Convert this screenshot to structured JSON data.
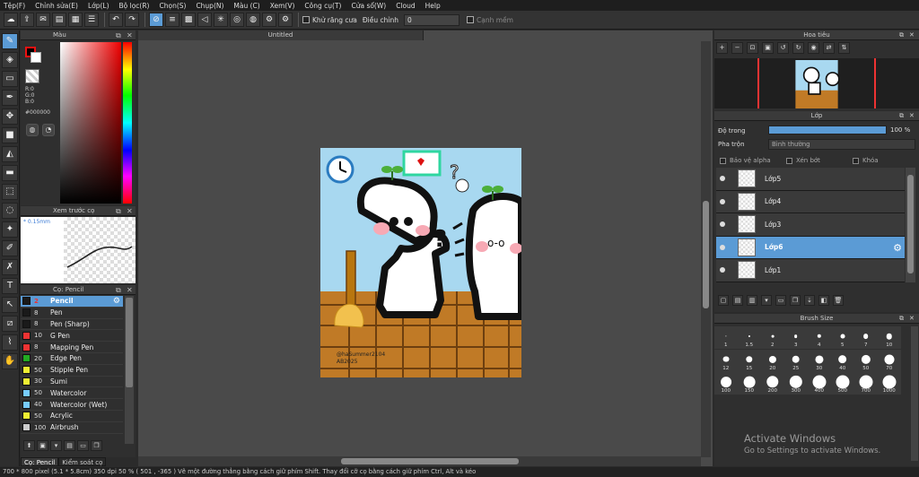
{
  "menu": [
    "Tệp(F)",
    "Chỉnh sửa(E)",
    "Lớp(L)",
    "Bộ lọc(R)",
    "Chọn(S)",
    "Chụp(N)",
    "Màu (C)",
    "Xem(V)",
    "Công cụ(T)",
    "Cửa sổ(W)",
    "Cloud",
    "Help"
  ],
  "toolbar": {
    "antialias_label": "Khử răng cưa",
    "adjust_label": "Điều chỉnh",
    "adjust_value": "0",
    "canh_mem_label": "Cạnh mềm"
  },
  "color_panel": {
    "title": "Màu",
    "r": "R:0",
    "g": "G:0",
    "b": "B:0",
    "hex": "#000000"
  },
  "brush_preview": {
    "title": "Xem trước cọ",
    "size": "0.15mm"
  },
  "brush_panel": {
    "title": "Cọ: Pencil",
    "brushes": [
      {
        "size": "2",
        "name": "Pencil",
        "color": "#1a1a1a",
        "selected": true
      },
      {
        "size": "8",
        "name": "Pen",
        "color": "#1a1a1a"
      },
      {
        "size": "8",
        "name": "Pen (Sharp)",
        "color": "#1a1a1a"
      },
      {
        "size": "10",
        "name": "G Pen",
        "color": "#e33"
      },
      {
        "size": "8",
        "name": "Mapping Pen",
        "color": "#e33"
      },
      {
        "size": "20",
        "name": "Edge Pen",
        "color": "#2a2"
      },
      {
        "size": "50",
        "name": "Stipple Pen",
        "color": "#ee3"
      },
      {
        "size": "30",
        "name": "Sumi",
        "color": "#ee3"
      },
      {
        "size": "50",
        "name": "Watercolor",
        "color": "#7cf"
      },
      {
        "size": "40",
        "name": "Watercolor (Wet)",
        "color": "#7cf"
      },
      {
        "size": "50",
        "name": "Acrylic",
        "color": "#ee3"
      },
      {
        "size": "100",
        "name": "Airbrush",
        "color": "#ccc"
      }
    ],
    "tab_pencil": "Cọ: Pencil",
    "tab_control": "Kiểm soát cọ"
  },
  "canvas": {
    "title": "Untitled"
  },
  "navigator": {
    "title": "Hoa tiêu"
  },
  "layer_panel": {
    "title": "Lớp",
    "opacity_label": "Độ trong",
    "opacity_value": "100 %",
    "blend_label": "Pha trộn",
    "blend_value": "Bình thường",
    "protect_alpha": "Bảo vệ alpha",
    "clip": "Xén bớt",
    "lock": "Khóa",
    "layers": [
      {
        "name": "Lớp5",
        "selected": false
      },
      {
        "name": "Lớp4",
        "selected": false
      },
      {
        "name": "Lớp3",
        "selected": false
      },
      {
        "name": "Lớp6",
        "selected": true
      },
      {
        "name": "Lớp1",
        "selected": false
      }
    ]
  },
  "brush_size": {
    "title": "Brush Size",
    "sizes": [
      "1",
      "1.5",
      "2",
      "3",
      "4",
      "5",
      "7",
      "10",
      "12",
      "15",
      "20",
      "25",
      "30",
      "40",
      "50",
      "70",
      "100",
      "150",
      "200",
      "300",
      "400",
      "500",
      "700",
      "1000"
    ]
  },
  "activate": {
    "title": "Activate Windows",
    "subtitle": "Go to Settings to activate Windows."
  },
  "status": "700 * 800 pixel   (5.1 * 5.8cm)   350 dpi   50 %   ( 501 , -365 )   Vẽ một đường thẳng bằng cách giữ phím Shift. Thay đổi cỡ cọ bằng cách giữ phím Ctrl, Alt và kéo",
  "artwork_signature": "@haSummer2104\nAB2025",
  "colors": {
    "accent": "#5b9bd5",
    "bg": "#2b2b2b"
  }
}
